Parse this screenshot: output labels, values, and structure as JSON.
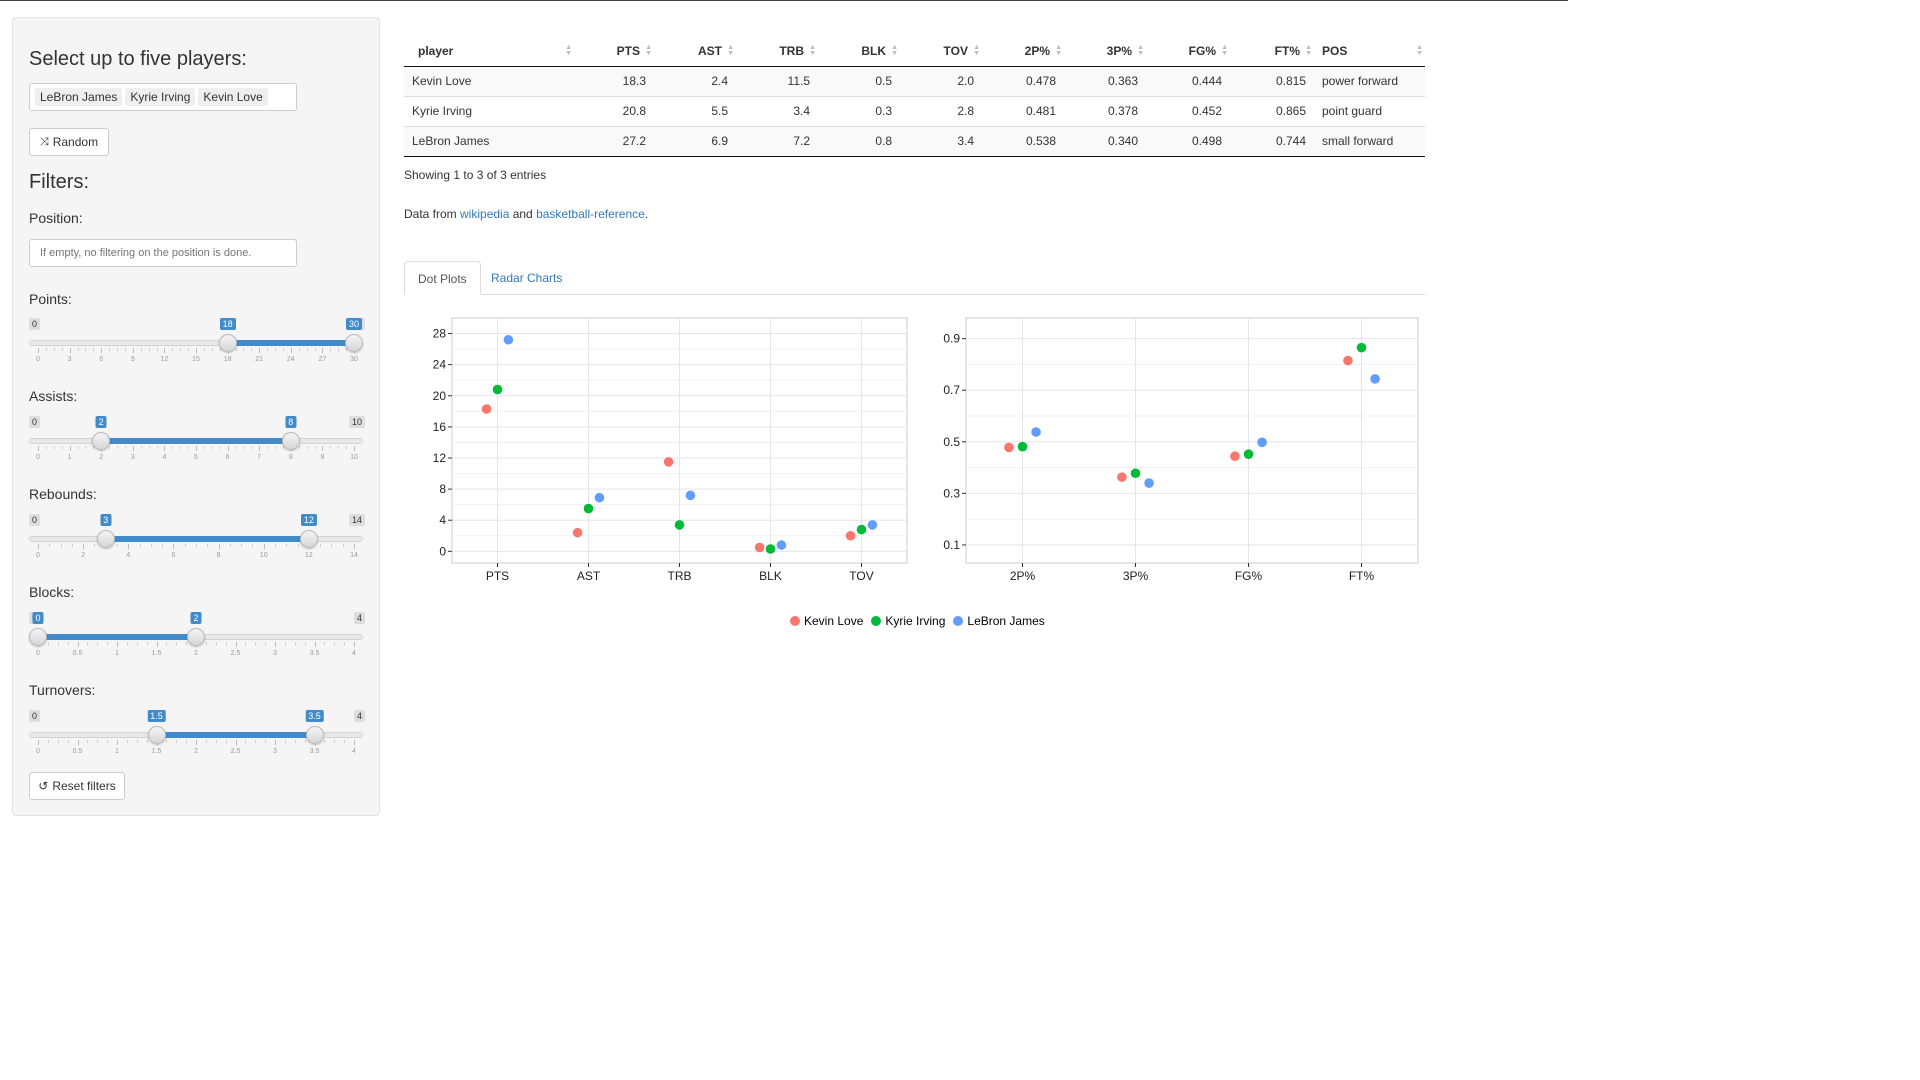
{
  "sidebar": {
    "select_title": "Select up to five players:",
    "selected_players": [
      "LeBron James",
      "Kyrie Irving",
      "Kevin Love"
    ],
    "random_label": "Random",
    "filters_title": "Filters:",
    "position_label": "Position:",
    "position_placeholder": "If empty, no filtering on the position is done.",
    "reset_label": "Reset filters",
    "sliders": [
      {
        "label": "Points:",
        "min": 0,
        "max": 30,
        "from": 18,
        "to": 30,
        "min_label": "0",
        "max_label": "30",
        "from_label": "18",
        "to_label": "30",
        "ticks": [
          "0",
          "3",
          "6",
          "9",
          "12",
          "15",
          "18",
          "21",
          "24",
          "27",
          "30"
        ]
      },
      {
        "label": "Assists:",
        "min": 0,
        "max": 10,
        "from": 2,
        "to": 8,
        "min_label": "0",
        "max_label": "10",
        "from_label": "2",
        "to_label": "8",
        "ticks": [
          "0",
          "1",
          "2",
          "3",
          "4",
          "5",
          "6",
          "7",
          "8",
          "9",
          "10"
        ]
      },
      {
        "label": "Rebounds:",
        "min": 0,
        "max": 14,
        "from": 3,
        "to": 12,
        "min_label": "0",
        "max_label": "14",
        "from_label": "3",
        "to_label": "12",
        "ticks": [
          "0",
          "2",
          "4",
          "6",
          "8",
          "10",
          "12",
          "14"
        ]
      },
      {
        "label": "Blocks:",
        "min": 0,
        "max": 4,
        "from": 0,
        "to": 2,
        "min_label": "0",
        "max_label": "4",
        "from_label": "0",
        "to_label": "2",
        "ticks": [
          "0",
          "0.5",
          "1",
          "1.5",
          "2",
          "2.5",
          "3",
          "3.5",
          "4"
        ]
      },
      {
        "label": "Turnovers:",
        "min": 0,
        "max": 4,
        "from": 1.5,
        "to": 3.5,
        "min_label": "0",
        "max_label": "4",
        "from_label": "1.5",
        "to_label": "3.5",
        "ticks": [
          "0",
          "0.5",
          "1",
          "1.5",
          "2",
          "2.5",
          "3",
          "3.5",
          "4"
        ]
      }
    ]
  },
  "table": {
    "columns": [
      "player",
      "PTS",
      "AST",
      "TRB",
      "BLK",
      "TOV",
      "2P%",
      "3P%",
      "FG%",
      "FT%",
      "POS"
    ],
    "rows": [
      [
        "Kevin Love",
        "18.3",
        "2.4",
        "11.5",
        "0.5",
        "2.0",
        "0.478",
        "0.363",
        "0.444",
        "0.815",
        "power forward"
      ],
      [
        "Kyrie Irving",
        "20.8",
        "5.5",
        "3.4",
        "0.3",
        "2.8",
        "0.481",
        "0.378",
        "0.452",
        "0.865",
        "point guard"
      ],
      [
        "LeBron James",
        "27.2",
        "6.9",
        "7.2",
        "0.8",
        "3.4",
        "0.538",
        "0.340",
        "0.498",
        "0.744",
        "small forward"
      ]
    ],
    "info": "Showing 1 to 3 of 3 entries"
  },
  "source": {
    "prefix": "Data from ",
    "link1": "wikipedia",
    "middle": " and ",
    "link2": "basketball-reference",
    "suffix": "."
  },
  "tabs": {
    "active": "Dot Plots",
    "inactive": "Radar Charts"
  },
  "chart_data": [
    {
      "type": "scatter",
      "title": "",
      "xlabel": "",
      "ylabel": "",
      "categories": [
        "PTS",
        "AST",
        "TRB",
        "BLK",
        "TOV"
      ],
      "ylim": [
        -1.5,
        30
      ],
      "yticks": [
        0,
        4,
        8,
        12,
        16,
        20,
        24,
        28
      ],
      "grid": true,
      "series": [
        {
          "name": "Kevin Love",
          "color": "#f8766d",
          "values": [
            18.3,
            2.4,
            11.5,
            0.5,
            2.0
          ]
        },
        {
          "name": "Kyrie Irving",
          "color": "#00ba38",
          "values": [
            20.8,
            5.5,
            3.4,
            0.3,
            2.8
          ]
        },
        {
          "name": "LeBron James",
          "color": "#619cff",
          "values": [
            27.2,
            6.9,
            7.2,
            0.8,
            3.4
          ]
        }
      ]
    },
    {
      "type": "scatter",
      "title": "",
      "xlabel": "",
      "ylabel": "",
      "categories": [
        "2P%",
        "3P%",
        "FG%",
        "FT%"
      ],
      "ylim": [
        0.03,
        0.98
      ],
      "yticks": [
        0.1,
        0.3,
        0.5,
        0.7,
        0.9
      ],
      "ytick_labels": [
        "0.1",
        "0.3",
        "0.5",
        "0.7",
        "0.9"
      ],
      "grid": true,
      "series": [
        {
          "name": "Kevin Love",
          "color": "#f8766d",
          "values": [
            0.478,
            0.363,
            0.444,
            0.815
          ]
        },
        {
          "name": "Kyrie Irving",
          "color": "#00ba38",
          "values": [
            0.481,
            0.378,
            0.452,
            0.865
          ]
        },
        {
          "name": "LeBron James",
          "color": "#619cff",
          "values": [
            0.538,
            0.34,
            0.498,
            0.744
          ]
        }
      ]
    }
  ],
  "legend": [
    {
      "name": "Kevin Love",
      "color": "#f8766d"
    },
    {
      "name": "Kyrie Irving",
      "color": "#00ba38"
    },
    {
      "name": "LeBron James",
      "color": "#619cff"
    }
  ]
}
